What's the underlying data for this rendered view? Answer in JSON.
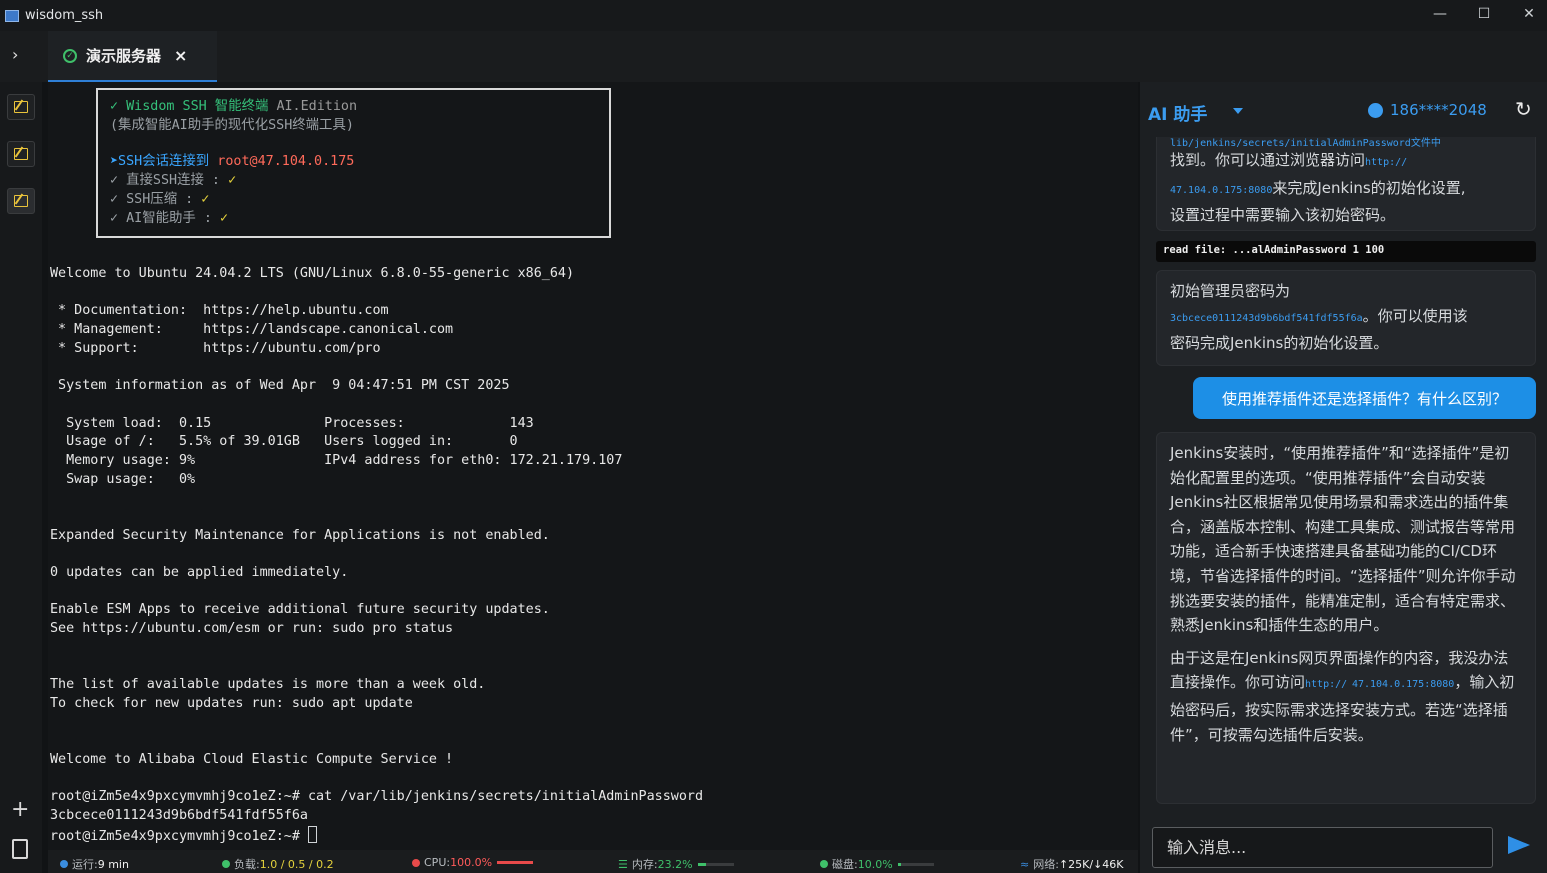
{
  "window": {
    "title": "wisdom_ssh",
    "controls": [
      "—",
      "☐",
      "✕"
    ]
  },
  "tabs": [
    {
      "label": "演示服务器",
      "close": "×",
      "status": "connected"
    }
  ],
  "banner": {
    "line1_check": "✓",
    "line1_app": "Wisdom SSH 智能终端",
    "line1_edition": "AI.Edition",
    "line2": "(集成智能AI助手的现代化SSH终端工具)",
    "session_prefix": "➤SSH会话连接到",
    "session_host": "root@47.104.0.175",
    "features": [
      {
        "label": "✓ 直接SSH连接  :",
        "mark": "✓"
      },
      {
        "label": "✓ SSH压缩     :",
        "mark": "✓"
      },
      {
        "label": "✓ AI智能助手   :",
        "mark": "✓"
      }
    ]
  },
  "terminal": {
    "lines": [
      "Welcome to Ubuntu 24.04.2 LTS (GNU/Linux 6.8.0-55-generic x86_64)",
      "",
      " * Documentation:  https://help.ubuntu.com",
      " * Management:     https://landscape.canonical.com",
      " * Support:        https://ubuntu.com/pro",
      "",
      " System information as of Wed Apr  9 04:47:51 PM CST 2025",
      "",
      "  System load:  0.15              Processes:             143",
      "  Usage of /:   5.5% of 39.01GB   Users logged in:       0",
      "  Memory usage: 9%                IPv4 address for eth0: 172.21.179.107",
      "  Swap usage:   0%",
      "",
      "",
      "Expanded Security Maintenance for Applications is not enabled.",
      "",
      "0 updates can be applied immediately.",
      "",
      "Enable ESM Apps to receive additional future security updates.",
      "See https://ubuntu.com/esm or run: sudo pro status",
      "",
      "",
      "The list of available updates is more than a week old.",
      "To check for new updates run: sudo apt update",
      "",
      "",
      "Welcome to Alibaba Cloud Elastic Compute Service !",
      "",
      "root@iZm5e4x9pxcymvmhj9co1eZ:~# cat /var/lib/jenkins/secrets/initialAdminPassword",
      "3cbcece0111243d9b6bdf541fdf55f6a"
    ],
    "prompt": "root@iZm5e4x9pxcymvmhj9co1eZ:~# "
  },
  "statusbar": {
    "uptime_label": "运行:",
    "uptime_value": "9 min",
    "load_label": "负载:",
    "load_value": "1.0 / 0.5 / 0.2",
    "cpu_label": "CPU:",
    "cpu_value": "100.0%",
    "cpu_fraction": 1.0,
    "mem_label": "内存:",
    "mem_value": "23.2%",
    "mem_fraction": 0.232,
    "disk_label": "磁盘:",
    "disk_value": "10.0%",
    "disk_fraction": 0.1,
    "net_label": "网络:",
    "net_value": "↑25K/↓46K",
    "colors": {
      "uptime": "#3a8de0",
      "load": "#3fc06a",
      "cpu": "#e84a4a",
      "mem": "#3fc06a",
      "disk": "#3fc06a",
      "net": "#3a8de0"
    }
  },
  "ai": {
    "title": "AI 助手",
    "user": "186****2048",
    "messages": {
      "m1_top": "lib/jenkins/secrets/initialAdminPassword文件中",
      "m1_a": "找到。你可以通过浏览器访问",
      "m1_url1": "http://",
      "m1_url2": "47.104.0.175:8080",
      "m1_b": "来完成Jenkins的初始化设置,",
      "m1_c": "设置过程中需要输入该初始密码。",
      "read_file": "read file: ...alAdminPassword 1 100",
      "m2_a": "初始管理员密码为",
      "m2_code": "3cbcece0111243d9b6bdf541fdf55f6a",
      "m2_b": "。你可以使用该",
      "m2_c": "密码完成Jenkins的初始化设置。",
      "user_q": "使用推荐插件还是选择插件？有什么区别？",
      "m3_p1": "Jenkins安装时，“使用推荐插件”和“选择插件”是初始化配置里的选项。“使用推荐插件”会自动安装Jenkins社区根据常见使用场景和需求选出的插件集合，涵盖版本控制、构建工具集成、测试报告等常用功能，适合新手快速搭建具备基础功能的CI/CD环境，节省选择插件的时间。“选择插件”则允许你手动挑选要安装的插件，能精准定制，适合有特定需求、熟悉Jenkins和插件生态的用户。",
      "m3_p2a": "由于这是在Jenkins网页界面操作的内容，我没办法直接操作。你可访问",
      "m3_url1": "http://",
      "m3_url2": "47.104.0.175:8080",
      "m3_p2b": "，输入初始密码后，按实际需求选择安装方式。若选“选择插件”，可按需勾选插件后安装。"
    },
    "input_placeholder": "输入消息..."
  }
}
